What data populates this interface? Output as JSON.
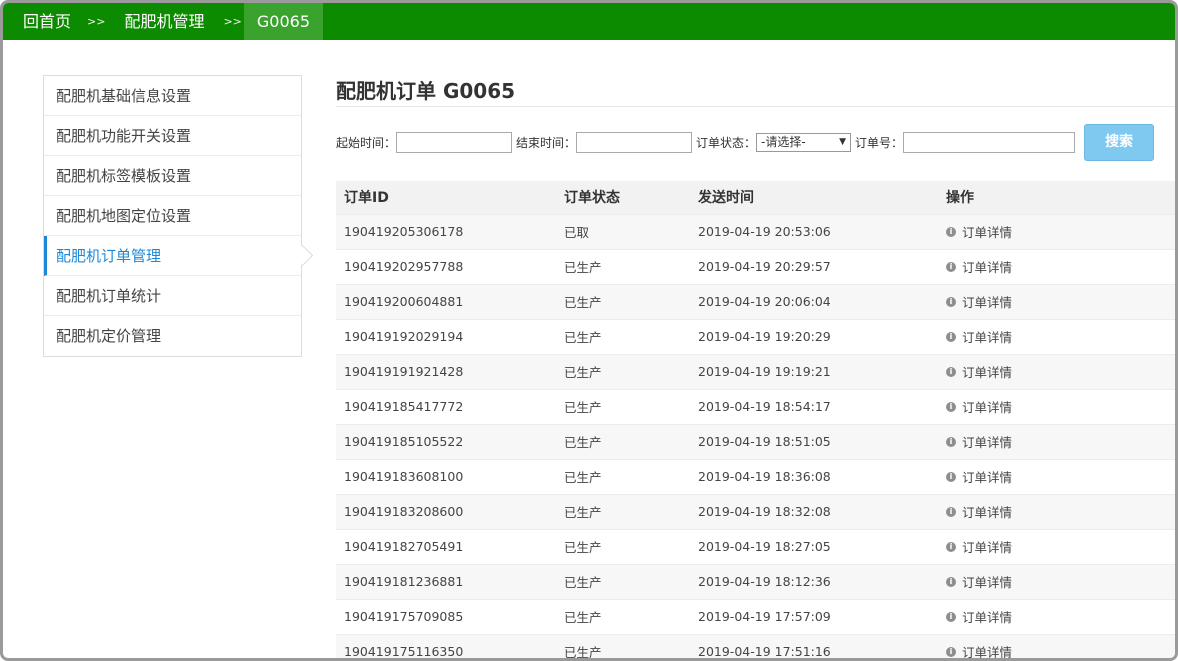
{
  "breadcrumb": {
    "home": "回首页",
    "separator": ">>",
    "section": "配肥机管理",
    "current": "G0065"
  },
  "sidebar": {
    "items": [
      {
        "label": "配肥机基础信息设置",
        "active": false
      },
      {
        "label": "配肥机功能开关设置",
        "active": false
      },
      {
        "label": "配肥机标签模板设置",
        "active": false
      },
      {
        "label": "配肥机地图定位设置",
        "active": false
      },
      {
        "label": "配肥机订单管理",
        "active": true
      },
      {
        "label": "配肥机订单统计",
        "active": false
      },
      {
        "label": "配肥机定价管理",
        "active": false
      }
    ]
  },
  "main": {
    "title": "配肥机订单 G0065",
    "filters": {
      "start_label": "起始时间：",
      "start_value": "",
      "end_label": "结束时间：",
      "end_value": "",
      "status_label": "订单状态：",
      "status_value": "-请选择-",
      "order_no_label": "订单号：",
      "order_no_value": "",
      "search_label": "搜索"
    },
    "table": {
      "columns": [
        "订单ID",
        "订单状态",
        "发送时间",
        "操作"
      ],
      "rows": [
        {
          "id": "190419205306178",
          "status": "已取",
          "time": "2019-04-19 20:53:06",
          "action": "订单详情"
        },
        {
          "id": "190419202957788",
          "status": "已生产",
          "time": "2019-04-19 20:29:57",
          "action": "订单详情"
        },
        {
          "id": "190419200604881",
          "status": "已生产",
          "time": "2019-04-19 20:06:04",
          "action": "订单详情"
        },
        {
          "id": "190419192029194",
          "status": "已生产",
          "time": "2019-04-19 19:20:29",
          "action": "订单详情"
        },
        {
          "id": "190419191921428",
          "status": "已生产",
          "time": "2019-04-19 19:19:21",
          "action": "订单详情"
        },
        {
          "id": "190419185417772",
          "status": "已生产",
          "time": "2019-04-19 18:54:17",
          "action": "订单详情"
        },
        {
          "id": "190419185105522",
          "status": "已生产",
          "time": "2019-04-19 18:51:05",
          "action": "订单详情"
        },
        {
          "id": "190419183608100",
          "status": "已生产",
          "time": "2019-04-19 18:36:08",
          "action": "订单详情"
        },
        {
          "id": "190419183208600",
          "status": "已生产",
          "time": "2019-04-19 18:32:08",
          "action": "订单详情"
        },
        {
          "id": "190419182705491",
          "status": "已生产",
          "time": "2019-04-19 18:27:05",
          "action": "订单详情"
        },
        {
          "id": "190419181236881",
          "status": "已生产",
          "time": "2019-04-19 18:12:36",
          "action": "订单详情"
        },
        {
          "id": "190419175709085",
          "status": "已生产",
          "time": "2019-04-19 17:57:09",
          "action": "订单详情"
        },
        {
          "id": "190419175116350",
          "status": "已生产",
          "time": "2019-04-19 17:51:16",
          "action": "订单详情"
        }
      ]
    }
  }
}
